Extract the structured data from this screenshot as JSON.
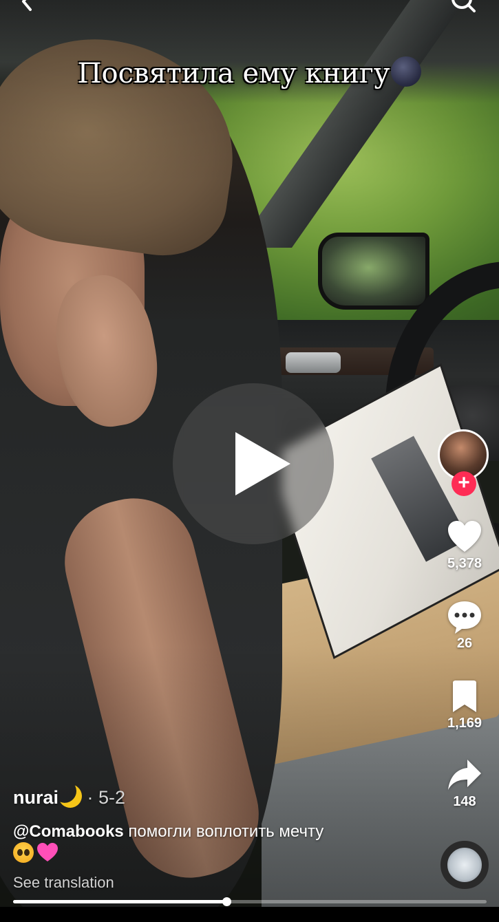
{
  "video": {
    "caption_text": "Посвятила ему книгу",
    "caption_emoji": "new-moon-face"
  },
  "top_bar": {
    "back_icon": "chevron-left-icon",
    "search_icon": "search-icon"
  },
  "actions": {
    "likes": "5,378",
    "comments": "26",
    "bookmarks": "1,169",
    "shares": "148"
  },
  "author": {
    "username": "nurai",
    "username_emoji": "crescent-moon",
    "separator_date": "· 5-2"
  },
  "description": {
    "mention": "@Comabooks",
    "text": " помогли воплотить мечту",
    "emojis": [
      "pleading-face",
      "pink-heart"
    ]
  },
  "see_translation": "See translation",
  "playback": {
    "state": "paused",
    "progress_fraction": 0.45
  },
  "colors": {
    "follow_accent": "#fe2c55",
    "text": "#ffffff"
  }
}
